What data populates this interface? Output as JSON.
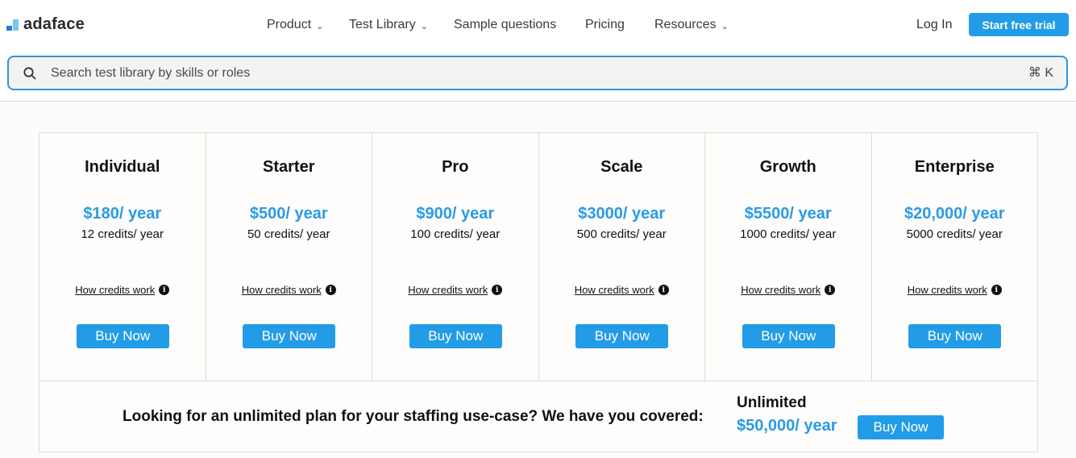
{
  "brand": {
    "name": "adaface",
    "accent": "#239ce8",
    "price_color": "#2a9be6"
  },
  "nav": {
    "items": [
      {
        "label": "Product",
        "has_dropdown": true,
        "icon": "chevron-down-icon"
      },
      {
        "label": "Test Library",
        "has_dropdown": true,
        "icon": "chevron-down-icon"
      },
      {
        "label": "Sample questions",
        "has_dropdown": false
      },
      {
        "label": "Pricing",
        "has_dropdown": false
      },
      {
        "label": "Resources",
        "has_dropdown": true,
        "icon": "chevron-down-icon"
      }
    ],
    "chevron": "⌄",
    "login_label": "Log In",
    "trial_label": "Start free trial"
  },
  "search": {
    "icon": "search-icon",
    "placeholder": "Search test library by skills or roles",
    "value": "",
    "shortcut": "⌘ K"
  },
  "plans": [
    {
      "name": "Individual",
      "price": "$180/ year",
      "credits": "12 credits/ year",
      "link": "How credits work",
      "button": "Buy Now"
    },
    {
      "name": "Starter",
      "price": "$500/ year",
      "credits": "50 credits/ year",
      "link": "How credits work",
      "button": "Buy Now"
    },
    {
      "name": "Pro",
      "price": "$900/ year",
      "credits": "100 credits/ year",
      "link": "How credits work",
      "button": "Buy Now"
    },
    {
      "name": "Scale",
      "price": "$3000/ year",
      "credits": "500 credits/ year",
      "link": "How credits work",
      "button": "Buy Now"
    },
    {
      "name": "Growth",
      "price": "$5500/ year",
      "credits": "1000 credits/ year",
      "link": "How credits work",
      "button": "Buy Now"
    },
    {
      "name": "Enterprise",
      "price": "$20,000/ year",
      "credits": "5000 credits/ year",
      "link": "How credits work",
      "button": "Buy Now"
    }
  ],
  "info_glyph": "i",
  "unlimited": {
    "text": "Looking for an unlimited plan for your staffing use-case? We have you covered:",
    "title": "Unlimited",
    "price": "$50,000/ year",
    "button": "Buy Now"
  }
}
